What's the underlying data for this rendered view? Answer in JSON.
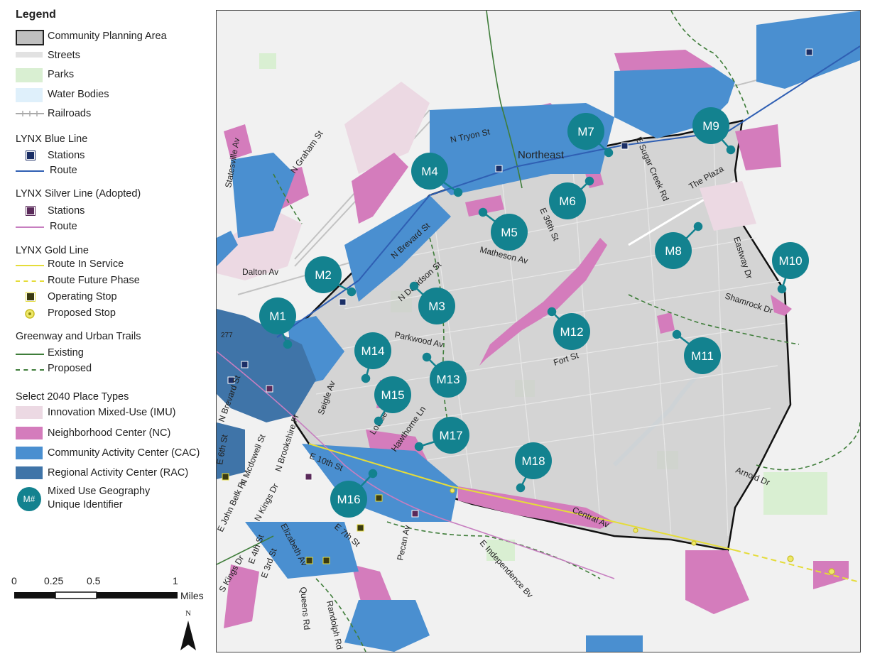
{
  "legend": {
    "title": "Legend",
    "community_planning_area": "Community Planning Area",
    "streets": "Streets",
    "parks": "Parks",
    "water_bodies": "Water Bodies",
    "railroads": "Railroads",
    "blue_line": {
      "title": "LYNX Blue Line",
      "stations": "Stations",
      "route": "Route"
    },
    "silver_line": {
      "title": "LYNX Silver Line (Adopted)",
      "stations": "Stations",
      "route": "Route"
    },
    "gold_line": {
      "title": "LYNX Gold Line",
      "in_service": "Route In Service",
      "future": "Route Future Phase",
      "operating": "Operating Stop",
      "proposed": "Proposed Stop"
    },
    "greenway": {
      "title": "Greenway and Urban Trails",
      "existing": "Existing",
      "proposed": "Proposed"
    },
    "place_types": {
      "title": "Select 2040 Place Types",
      "imu": "Innovation Mixed-Use (IMU)",
      "nc": "Neighborhood Center (NC)",
      "cac": "Community Activity Center (CAC)",
      "rac": "Regional Activity Center (RAC)"
    },
    "mixed_use_1": "Mixed Use Geography",
    "mixed_use_2": "Unique Identifier",
    "marker_symbol": "M#"
  },
  "scale": {
    "labels": [
      "0",
      "0.25",
      "0.5",
      "1"
    ],
    "unit": "Miles"
  },
  "north": "N",
  "colors": {
    "imu": "#ecd9e3",
    "nc": "#d47cbc",
    "cac": "#4a8fd0",
    "rac": "#3f74a8",
    "park": "#d9efd2",
    "water": "#dff0fb",
    "cpa": "#c8c8c8",
    "marker": "#13828f",
    "blue_route": "#2f5fb3",
    "silver_route": "#c77ec0",
    "gold": "#e5dc3a",
    "greenway": "#3f7d3a"
  },
  "streets": [
    "Northeast",
    "N Tryon St",
    "N Graham St",
    "Statesville Av",
    "E Sugar Creek Rd",
    "The Plaza",
    "E 36th St",
    "N Brevard St",
    "N Davidson St",
    "Matheson Av",
    "Dalton Av",
    "Eastway Dr",
    "Shamrock Dr",
    "Parkwood Av",
    "Fort St",
    "Seigle Av",
    "Louise Av",
    "Hawthorne Ln",
    "E 10th St",
    "N Brookshire Fr",
    "N Mcdowell St",
    "N Kings Dr",
    "Arnold Dr",
    "Central Av",
    "E 7th St",
    "E Independence Bv",
    "Pecan Av",
    "Elizabeth Av",
    "Queens Rd",
    "Randolph Rd",
    "E 4th St",
    "E 3rd St",
    "S Kings Dr",
    "E John Belk Fr",
    "E 6th St",
    "N Brevard St",
    "277"
  ],
  "markers": [
    "M1",
    "M2",
    "M3",
    "M4",
    "M5",
    "M6",
    "M7",
    "M8",
    "M9",
    "M10",
    "M11",
    "M12",
    "M13",
    "M14",
    "M15",
    "M16",
    "M17",
    "M18"
  ]
}
